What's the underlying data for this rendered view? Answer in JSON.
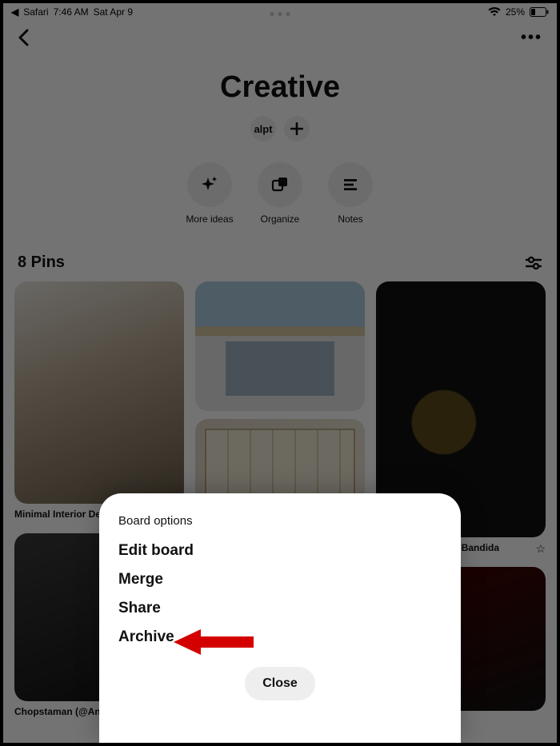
{
  "status": {
    "back_app": "Safari",
    "time": "7:46 AM",
    "date": "Sat Apr 9",
    "battery_pct": "25%"
  },
  "board": {
    "title": "Creative",
    "collaborator_initials": "alpt",
    "actions": {
      "more_ideas": "More ideas",
      "organize": "Organize",
      "notes": "Notes"
    },
    "pin_count_label": "8 Pins"
  },
  "pins": {
    "col1": {
      "a_title": "Minimal Interior Design 175",
      "b_title": "Chopstaman (@Ant"
    },
    "col3": {
      "a_title": "R nineT Tracker la Bandida"
    }
  },
  "sheet": {
    "title": "Board options",
    "edit": "Edit board",
    "merge": "Merge",
    "share": "Share",
    "archive": "Archive",
    "close": "Close"
  }
}
